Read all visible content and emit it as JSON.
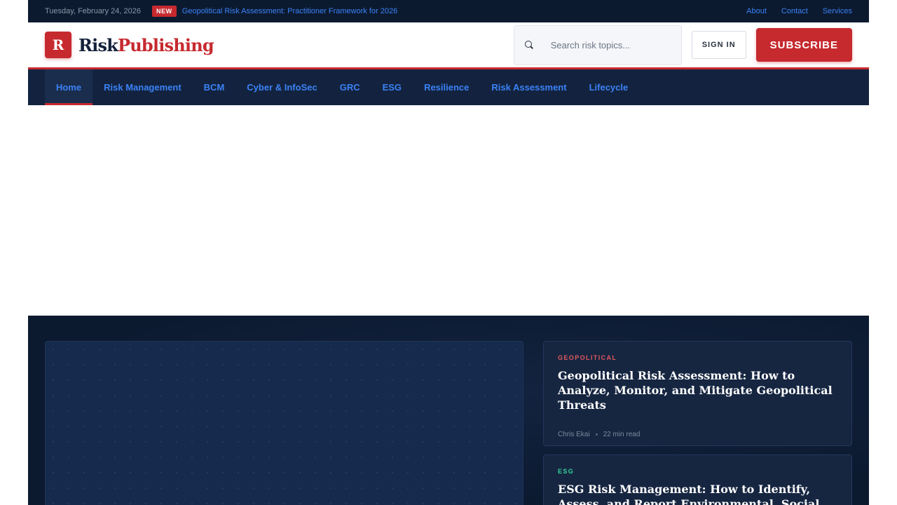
{
  "topbar": {
    "date": "Tuesday, February 24, 2026",
    "badge": "NEW",
    "ticker": "Geopolitical Risk Assessment: Practitioner Framework for 2026",
    "links": [
      "About",
      "Contact",
      "Services"
    ]
  },
  "header": {
    "logo_letter": "R",
    "logo_part1": "Risk",
    "logo_part2": "Publishing",
    "search_placeholder": "Search risk topics...",
    "signin_label": "SIGN IN",
    "subscribe_label": "SUBSCRIBE"
  },
  "nav": {
    "items": [
      "Home",
      "Risk Management",
      "BCM",
      "Cyber & InfoSec",
      "GRC",
      "ESG",
      "Resilience",
      "Risk Assessment",
      "Lifecycle"
    ],
    "active": "Home"
  },
  "hero": {
    "cards": [
      {
        "category": "GEOPOLITICAL",
        "category_color": "#e0585c",
        "title": "Geopolitical Risk Assessment: How to Analyze, Monitor, and Mitigate Geopolitical Threats",
        "author": "Chris Ekai",
        "read_time": "22 min read"
      },
      {
        "category": "ESG",
        "category_color": "#34d399",
        "title": "ESG Risk Management: How to Identify, Assess, and Report Environmental, Social, and"
      }
    ]
  },
  "colors": {
    "brand_red": "#c62a2f",
    "navy": "#0c1a30",
    "link_blue": "#3b82f6"
  }
}
